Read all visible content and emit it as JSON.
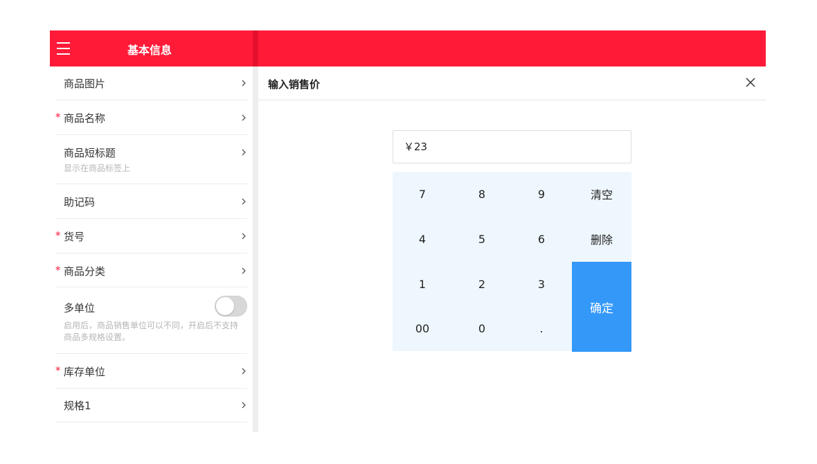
{
  "header": {
    "title": "基本信息"
  },
  "form": {
    "product_image": "商品图片",
    "product_name": "商品名称",
    "short_title": "商品短标题",
    "short_title_hint": "显示在商品标签上",
    "mnemonic_code": "助记码",
    "item_no": "货号",
    "category": "商品分类",
    "multi_unit": "多单位",
    "multi_unit_hint": "启用后，商品销售单位可以不同，开启后不支持商品多规格设置。",
    "multi_unit_enabled": false,
    "stock_unit": "库存单位",
    "spec1": "规格1",
    "required_mark": "*"
  },
  "dialog": {
    "title": "输入销售价",
    "price_value": "￥23"
  },
  "keypad": {
    "k7": "7",
    "k8": "8",
    "k9": "9",
    "clear": "清空",
    "k4": "4",
    "k5": "5",
    "k6": "6",
    "delete": "删除",
    "k1": "1",
    "k2": "2",
    "k3": "3",
    "confirm": "确定",
    "k00": "00",
    "k0": "0",
    "dot": "."
  },
  "colors": {
    "brand_red": "#ff1a38",
    "keypad_bg": "#eef7fd",
    "confirm_blue": "#3498f9"
  }
}
